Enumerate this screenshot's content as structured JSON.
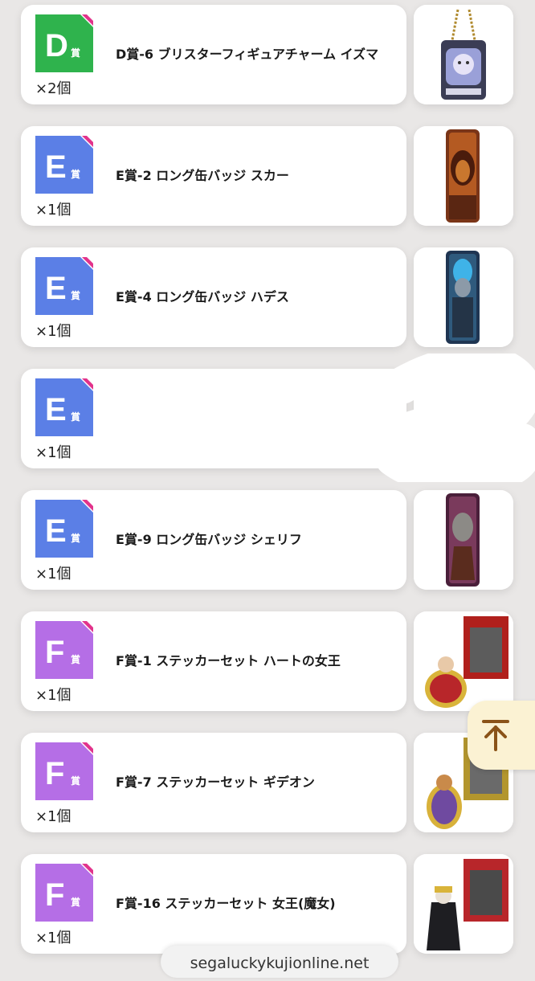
{
  "colors": {
    "D": "#2fb34d",
    "E": "#5b7fe6",
    "F": "#b56ee6",
    "corner": "#e2338b",
    "top_arrow": "#8a5318"
  },
  "items": [
    {
      "grade": "D",
      "badge_letter": "D",
      "badge_suffix": "賞",
      "title": "D賞-6 ブリスターフィギュアチャーム イズマ",
      "qty": "×2個",
      "image": "blister-charm-yzma"
    },
    {
      "grade": "E",
      "badge_letter": "E",
      "badge_suffix": "賞",
      "title": "E賞-2 ロング缶バッジ スカー",
      "qty": "×1個",
      "image": "long-badge-scar"
    },
    {
      "grade": "E",
      "badge_letter": "E",
      "badge_suffix": "賞",
      "title": "E賞-4 ロング缶バッジ ハデス",
      "qty": "×1個",
      "image": "long-badge-hades"
    },
    {
      "grade": "E",
      "badge_letter": "E",
      "badge_suffix": "賞",
      "title": "",
      "qty": "×1個",
      "image": "hidden"
    },
    {
      "grade": "E",
      "badge_letter": "E",
      "badge_suffix": "賞",
      "title": "E賞-9 ロング缶バッジ シェリフ",
      "qty": "×1個",
      "image": "long-badge-sheriff"
    },
    {
      "grade": "F",
      "badge_letter": "F",
      "badge_suffix": "賞",
      "title": "F賞-1 ステッカーセット ハートの女王",
      "qty": "×1個",
      "image": "sticker-queen-of-hearts"
    },
    {
      "grade": "F",
      "badge_letter": "F",
      "badge_suffix": "賞",
      "title": "F賞-7 ステッカーセット ギデオン",
      "qty": "×1個",
      "image": "sticker-gideon"
    },
    {
      "grade": "F",
      "badge_letter": "F",
      "badge_suffix": "賞",
      "title": "F賞-16 ステッカーセット 女王(魔女)",
      "qty": "×1個",
      "image": "sticker-evil-queen"
    }
  ],
  "url_text": "segaluckykujionline.net"
}
